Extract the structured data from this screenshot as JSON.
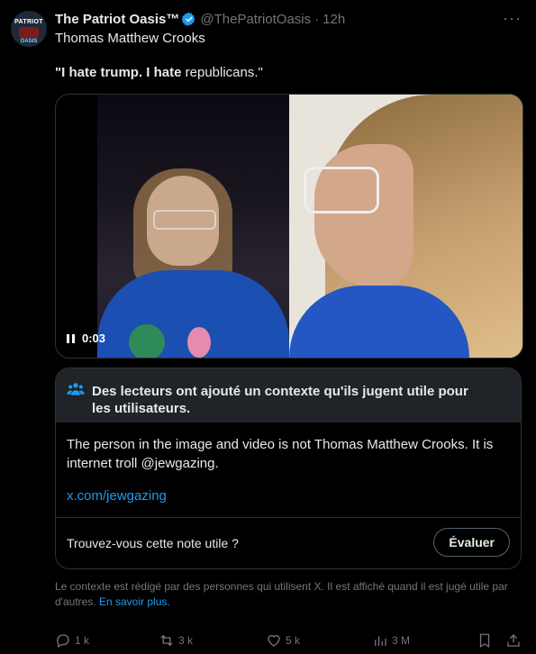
{
  "post": {
    "display_name": "The Patriot Oasis™",
    "handle": "@ThePatriotOasis",
    "separator": "·",
    "time": "12h",
    "more": "···",
    "line1": "Thomas Matthew Crooks",
    "quote_bold": "\"I hate trump. I hate",
    "quote_rest": " republicans.\""
  },
  "avatar": {
    "top_text": "PATRIOT",
    "bottom_text": "OASIS"
  },
  "video": {
    "timestamp": "0:03"
  },
  "community_note": {
    "title": "Des lecteurs ont ajouté un contexte qu'ils jugent utile pour les utilisateurs.",
    "body": "The person in the image and video is not Thomas Matthew Crooks. It is internet troll @jewgazing.",
    "link": "x.com/jewgazing",
    "question": "Trouvez-vous cette note utile ?",
    "rate_button": "Évaluer"
  },
  "context_footer": {
    "text": "Le contexte est rédigé par des personnes qui utilisent X. Il est affiché quand il est jugé utile par d'autres.",
    "link": "En savoir plus."
  },
  "actions": {
    "replies": "1 k",
    "reposts": "3 k",
    "likes": "5 k",
    "views": "3 M"
  },
  "colors": {
    "accent": "#1d9bf0",
    "muted": "#71767b",
    "background": "#000000"
  }
}
